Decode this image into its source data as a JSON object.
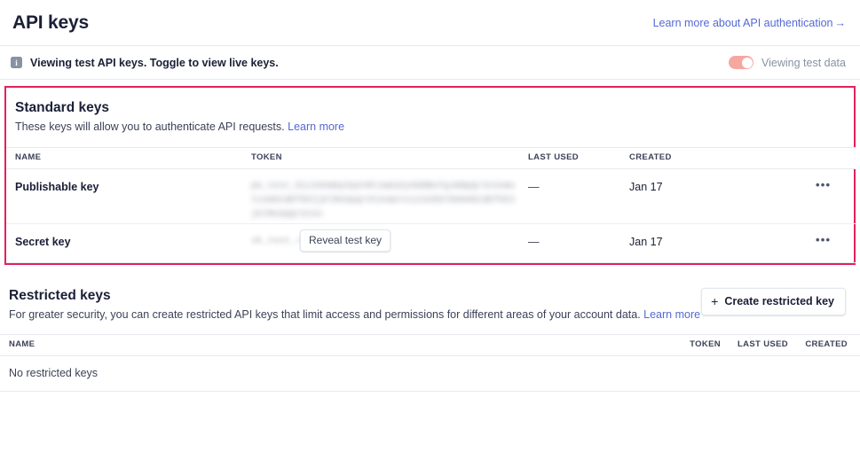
{
  "header": {
    "title": "API keys",
    "learn_more_link": "Learn more about API authentication",
    "arrow": "→"
  },
  "test_banner": {
    "info_icon": "info-icon",
    "message": "Viewing test API keys. Toggle to view live keys.",
    "toggle_label": "Viewing test data",
    "toggle_on": true,
    "toggle_color": "#f5a7a0"
  },
  "standard_keys": {
    "highlighted": true,
    "highlight_color": "#e3215b",
    "title": "Standard keys",
    "description": "These keys will allow you to authenticate API requests.",
    "learn_more": "Learn more",
    "columns": [
      "NAME",
      "TOKEN",
      "LAST USED",
      "CREATED"
    ],
    "rows": [
      {
        "name": "Publishable key",
        "token_masked": "pk_test_51Lk9XmKp3qVnRt2wEaZyHd8BcFgJmNpQrStUvWxYz4AbCdEfGhIjKlMnOpQrStUvWxYz1234567890AbCdEfGhIjKlMnOpQrStUv",
        "last_used": "—",
        "created": "Jan 17",
        "menu": "•••",
        "blurred": true
      },
      {
        "name": "Secret key",
        "token_masked": "sk_test_••••••••••••••••",
        "reveal_button": "Reveal test key",
        "last_used": "—",
        "created": "Jan 17",
        "menu": "•••",
        "blurred": true
      }
    ]
  },
  "restricted_keys": {
    "title": "Restricted keys",
    "description": "For greater security, you can create restricted API keys that limit access and permissions for different areas of your account data.",
    "learn_more": "Learn more",
    "create_button": "Create restricted key",
    "plus_icon": "+",
    "columns": [
      "NAME",
      "TOKEN",
      "LAST USED",
      "CREATED"
    ],
    "empty_message": "No restricted keys"
  }
}
